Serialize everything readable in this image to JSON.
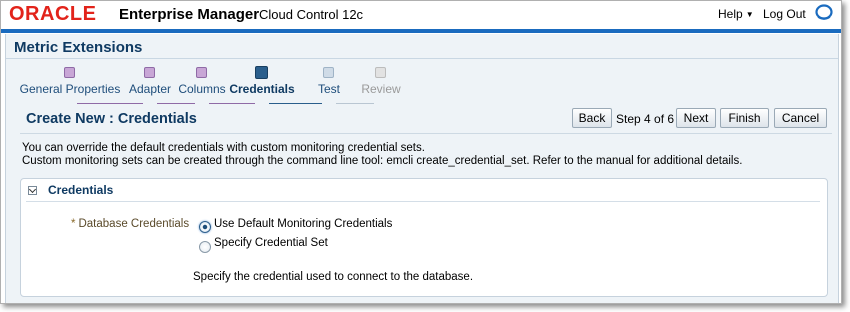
{
  "header": {
    "brand": "ORACLE",
    "product": "Enterprise Manager",
    "edition": "Cloud Control 12c",
    "help_label": "Help",
    "logout_label": "Log Out",
    "globe_icon": "oracle-globe-icon"
  },
  "page": {
    "title": "Metric Extensions"
  },
  "train": {
    "steps": [
      {
        "label": "General Properties",
        "state": "visited"
      },
      {
        "label": "Adapter",
        "state": "visited"
      },
      {
        "label": "Columns",
        "state": "visited"
      },
      {
        "label": "Credentials",
        "state": "current"
      },
      {
        "label": "Test",
        "state": "next"
      },
      {
        "label": "Review",
        "state": "disabled"
      }
    ]
  },
  "wizard": {
    "title": "Create New : Credentials",
    "back_label": "Back",
    "step_text": "Step 4 of 6",
    "next_label": "Next",
    "finish_label": "Finish",
    "cancel_label": "Cancel"
  },
  "description": {
    "line1": "You can override the default credentials with custom monitoring credential sets.",
    "line2": "Custom monitoring sets can be created through the command line tool: emcli create_credential_set. Refer to the manual for additional details."
  },
  "credentials_section": {
    "title": "Credentials",
    "field_label": "Database Credentials",
    "required_mark": "*",
    "option_default": "Use Default Monitoring Credentials",
    "option_specify": "Specify Credential Set",
    "selected_option": "Use Default Monitoring Credentials",
    "hint": "Specify the credential used to connect to the database."
  },
  "colors": {
    "brand_red": "#e2231a",
    "title_blue": "#0f3a62",
    "rule_blue": "#1a6bbf",
    "visited_purple": "#c8a6d6"
  }
}
